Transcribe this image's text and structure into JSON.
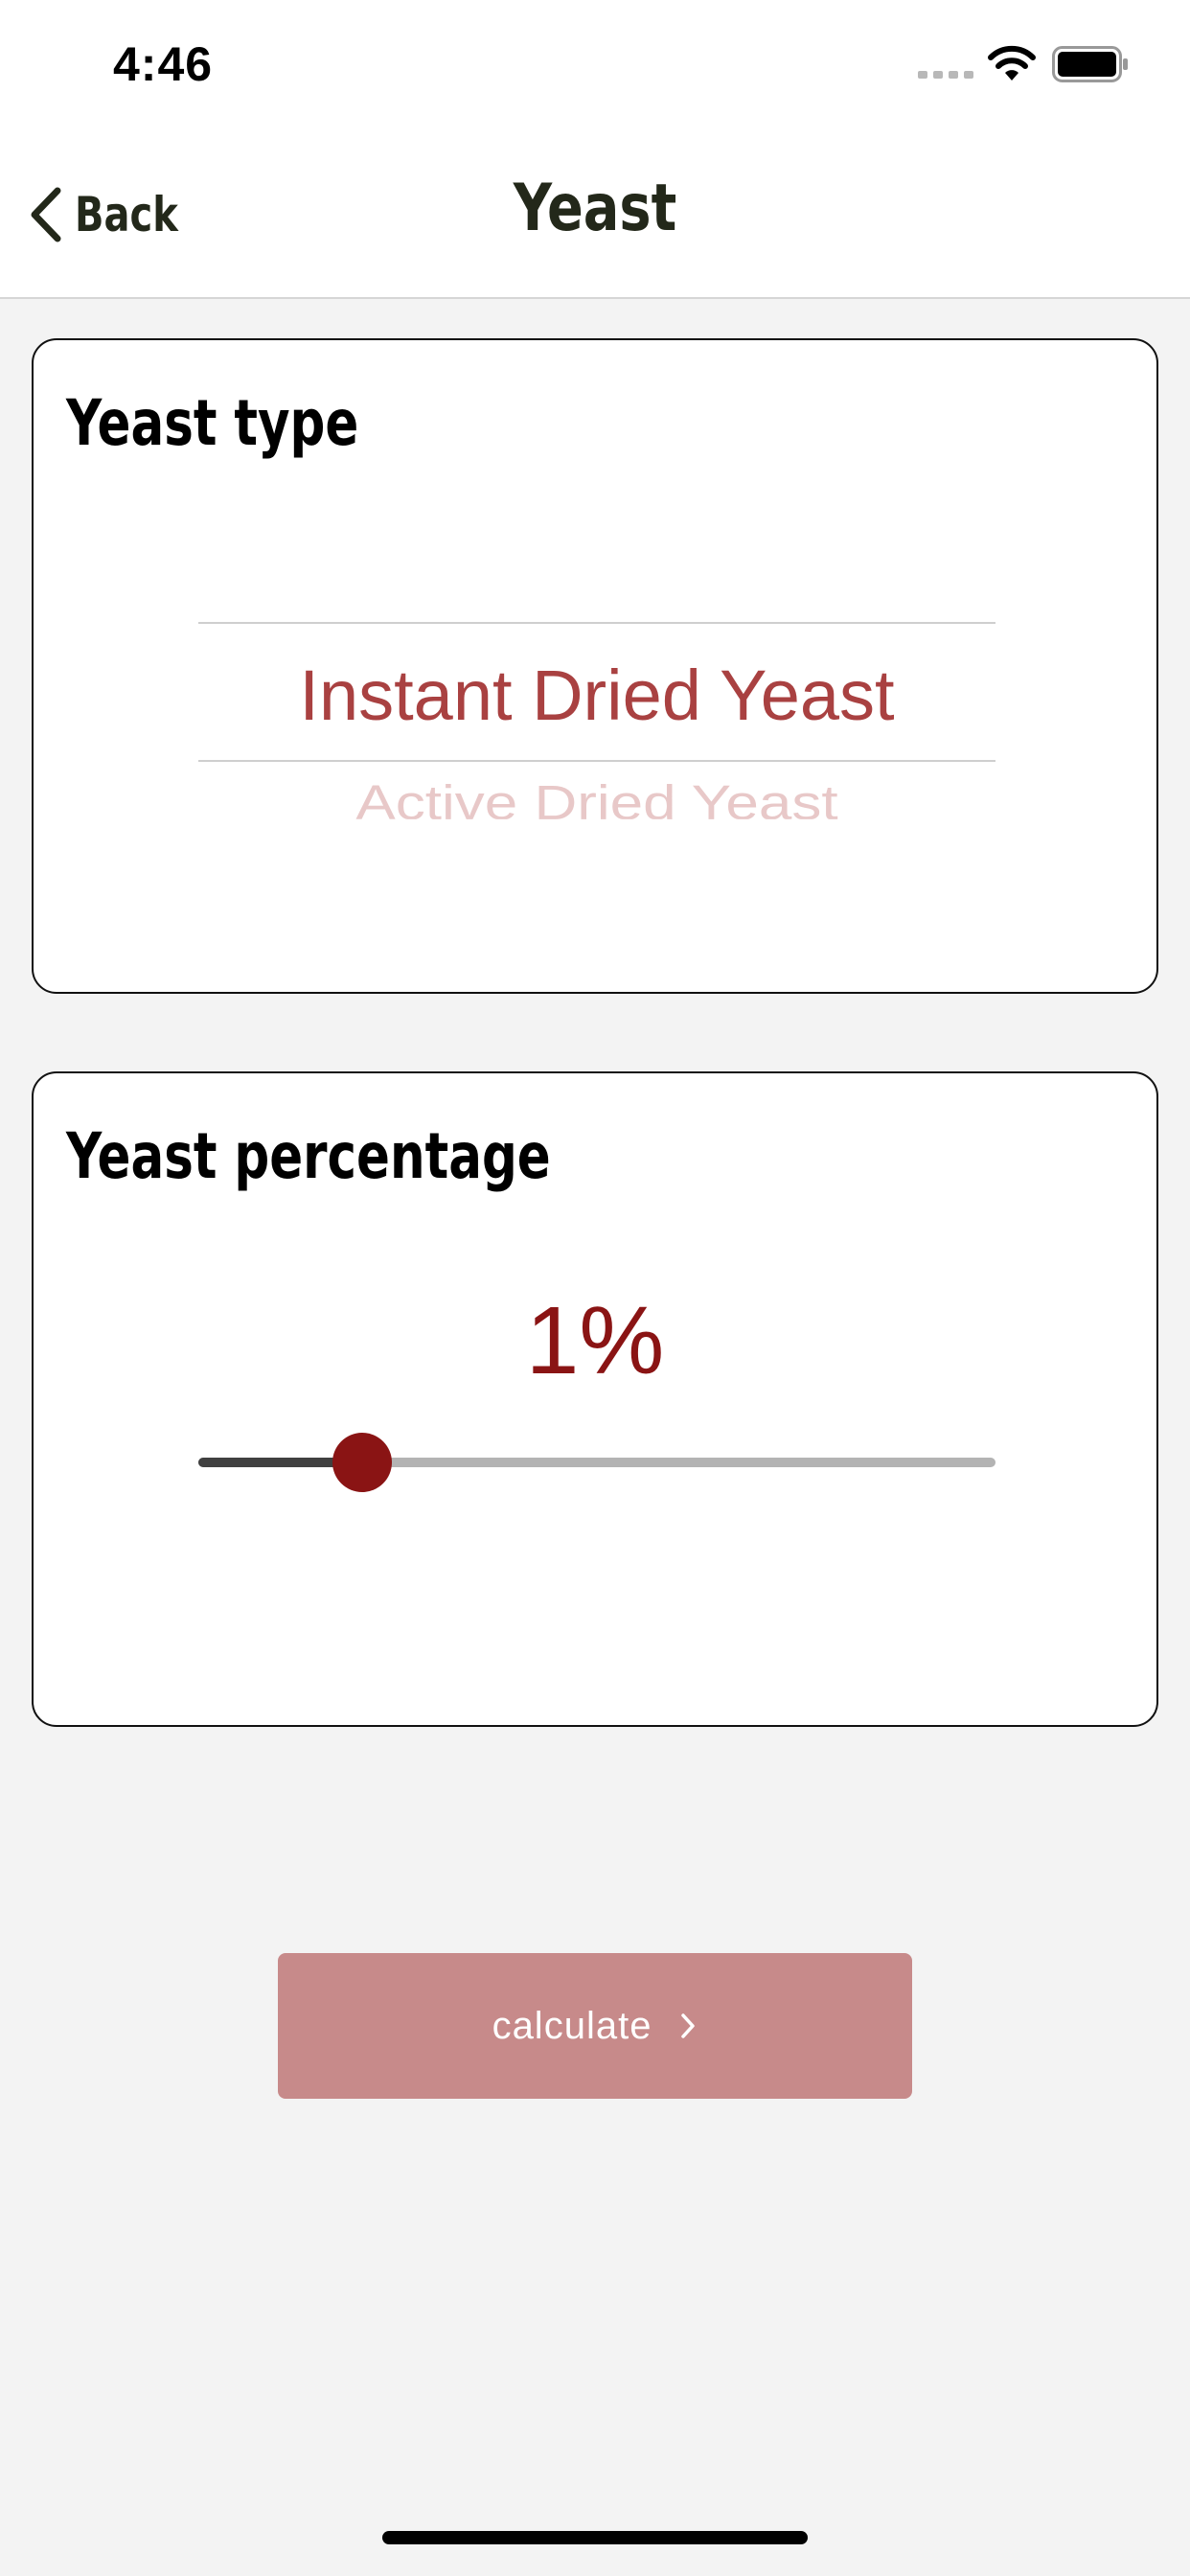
{
  "status_bar": {
    "time": "4:46",
    "icons": [
      "cellular-signal-icon",
      "wifi-icon",
      "battery-icon"
    ]
  },
  "nav": {
    "back_label": "Back",
    "title": "Yeast"
  },
  "yeast_type": {
    "title": "Yeast type",
    "selected_option": "Instant Dried Yeast",
    "next_option": "Active Dried Yeast"
  },
  "yeast_percentage": {
    "title": "Yeast percentage",
    "value_label": "1%",
    "slider_fraction": 0.205
  },
  "calculate": {
    "label": "calculate",
    "icon": "chevron-right-icon"
  },
  "colors": {
    "accent": "#8a1414",
    "picker_selected": "#a94141",
    "button_bg": "#c78a8a",
    "nav_text": "#23281a",
    "background": "#f3f3f3"
  }
}
